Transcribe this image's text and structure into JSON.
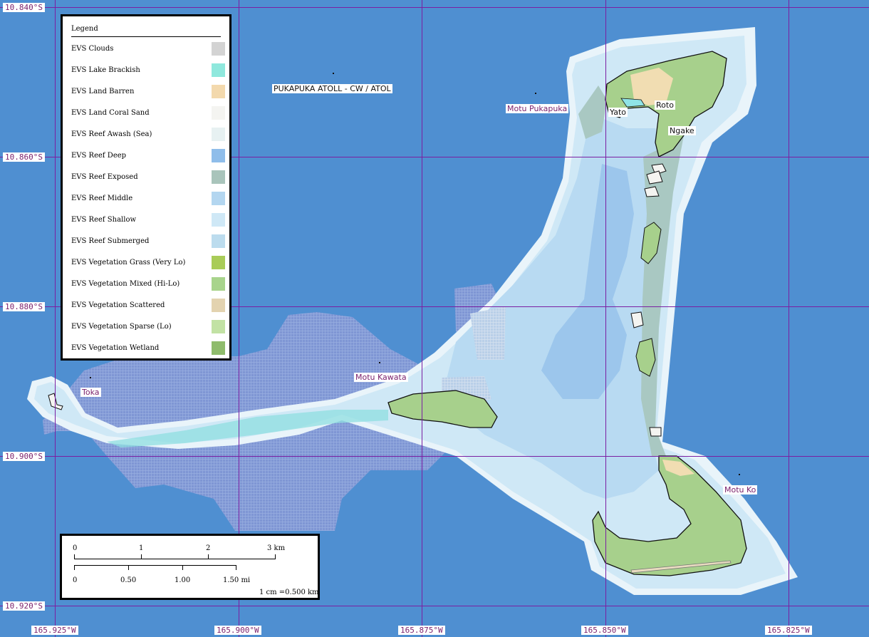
{
  "map": {
    "place_labels": [
      {
        "name": "Motu Pukapuka"
      },
      {
        "name": "Yato"
      },
      {
        "name": "Roto"
      },
      {
        "name": "Ngake"
      },
      {
        "name": "PUKAPUKA ATOLL - CW / ATOL"
      },
      {
        "name": "Motu Kawata"
      },
      {
        "name": "Toka"
      },
      {
        "name": "Motu Ko"
      }
    ],
    "graticule": {
      "lat_labels": [
        "10.840°S",
        "10.860°S",
        "10.880°S",
        "10.900°S",
        "10.920°S"
      ],
      "lon_labels": [
        "165.925°W",
        "165.900°W",
        "165.875°W",
        "165.850°W",
        "165.825°W"
      ]
    },
    "colors": {
      "ocean": "#4f8fd1",
      "graticule": "#7b1fa2",
      "reef_shallow": "#cfe8f6",
      "reef_middle": "#b6d9f2",
      "reef_deep": "#8fbdea",
      "reef_awash": "#e9f4fa",
      "reef_exposed": "#a9c8c2",
      "vegetation": "#a7d08c",
      "sand": "#f1ddb2",
      "lagoon_brackish": "#8fe4e6",
      "hatched_zone": "#7b91d0"
    }
  },
  "legend": {
    "title": "Legend",
    "items": [
      {
        "label": "EVS Clouds",
        "color": "#d3d3d3"
      },
      {
        "label": "EVS Lake Brackish",
        "color": "#8fe8dd"
      },
      {
        "label": "EVS Land Barren",
        "color": "#f3d9ad"
      },
      {
        "label": "EVS Land Coral Sand",
        "color": "#f4f4f1"
      },
      {
        "label": "EVS Reef Awash (Sea)",
        "color": "#e7f1f2"
      },
      {
        "label": "EVS Reef Deep",
        "color": "#8fbdea"
      },
      {
        "label": "EVS Reef Exposed",
        "color": "#a9c4bb"
      },
      {
        "label": "EVS Reef Middle",
        "color": "#b3d6f0"
      },
      {
        "label": "EVS Reef Shallow",
        "color": "#cfe8f6"
      },
      {
        "label": "EVS Reef Submerged",
        "color": "#bcdcee"
      },
      {
        "label": "EVS Vegetation Grass (Very Lo)",
        "color": "#a9cc58"
      },
      {
        "label": "EVS Vegetation Mixed (Hi-Lo)",
        "color": "#a8d48c"
      },
      {
        "label": "EVS Vegetation Scattered",
        "color": "#e3d3b0"
      },
      {
        "label": "EVS Vegetation Sparse (Lo)",
        "color": "#c2e2a4"
      },
      {
        "label": "EVS Vegetation Wetland",
        "color": "#8fbc6c"
      }
    ]
  },
  "scalebar": {
    "km_ticks": [
      "0",
      "1",
      "2",
      "3 km"
    ],
    "mi_ticks": [
      "0",
      "0.50",
      "1.00",
      "1.50 mi"
    ],
    "ratio": "1 cm =0.500 km"
  }
}
